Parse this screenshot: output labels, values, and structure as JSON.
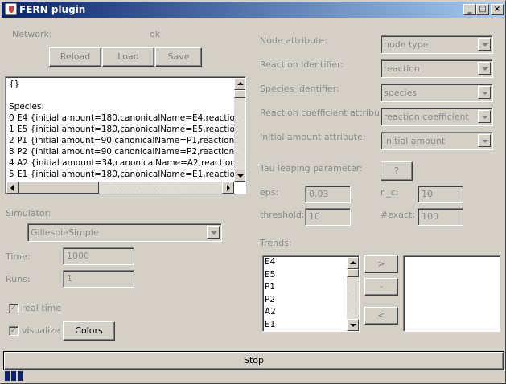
{
  "window": {
    "title": "FERN plugin",
    "minimize": "_",
    "maximize": "□",
    "close": "×"
  },
  "network": {
    "label": "Network:",
    "status": "ok"
  },
  "buttons": {
    "reload": "Reload",
    "load": "Load",
    "save": "Save",
    "colors": "Colors",
    "tau_help": "?",
    "stop": "Stop",
    "add": ">",
    "remove": "-",
    "remove_all": "<"
  },
  "textarea": {
    "text": "{}\n\nSpecies:\n0 E4 {initial amount=180,canonicalName=E4,reaction coef\n1 E5 {initial amount=180,canonicalName=E5,reaction coef\n2 P1 {initial amount=90,canonicalName=P1,reaction coeff\n3 P2 {initial amount=90,canonicalName=P2,reaction coeff\n4 A2 {initial amount=34,canonicalName=A2,reaction coeff\n5 E1 {initial amount=180,canonicalName=E1,reaction coef"
  },
  "simulator": {
    "label": "Simulator:",
    "value": "GillespieSimple",
    "time_label": "Time:",
    "time_value": "1000",
    "runs_label": "Runs:",
    "runs_value": "1",
    "realtime_label": "real time",
    "visualize_label": "visualize"
  },
  "attributes": {
    "node_label": "Node attribute:",
    "node_value": "node type",
    "reaction_label": "Reaction identifier:",
    "reaction_value": "reaction",
    "species_label": "Species identifier:",
    "species_value": "species",
    "coef_label": "Reaction coefficient attribute:",
    "coef_value": "reaction coefficient",
    "initial_label": "Initial amount attribute:",
    "initial_value": "initial amount"
  },
  "tau": {
    "label": "Tau leaping parameter:",
    "eps_label": "eps:",
    "eps_value": "0.03",
    "nc_label": "n_c:",
    "nc_value": "10",
    "threshold_label": "threshold:",
    "threshold_value": "10",
    "exact_label": "#exact:",
    "exact_value": "100"
  },
  "trends": {
    "label": "Trends:",
    "items": [
      "E4",
      "E5",
      "P1",
      "P2",
      "A2",
      "E1"
    ]
  },
  "colors": {
    "title_start": "#0a246a",
    "title_end": "#a6caf0",
    "face": "#d4d0c8"
  }
}
